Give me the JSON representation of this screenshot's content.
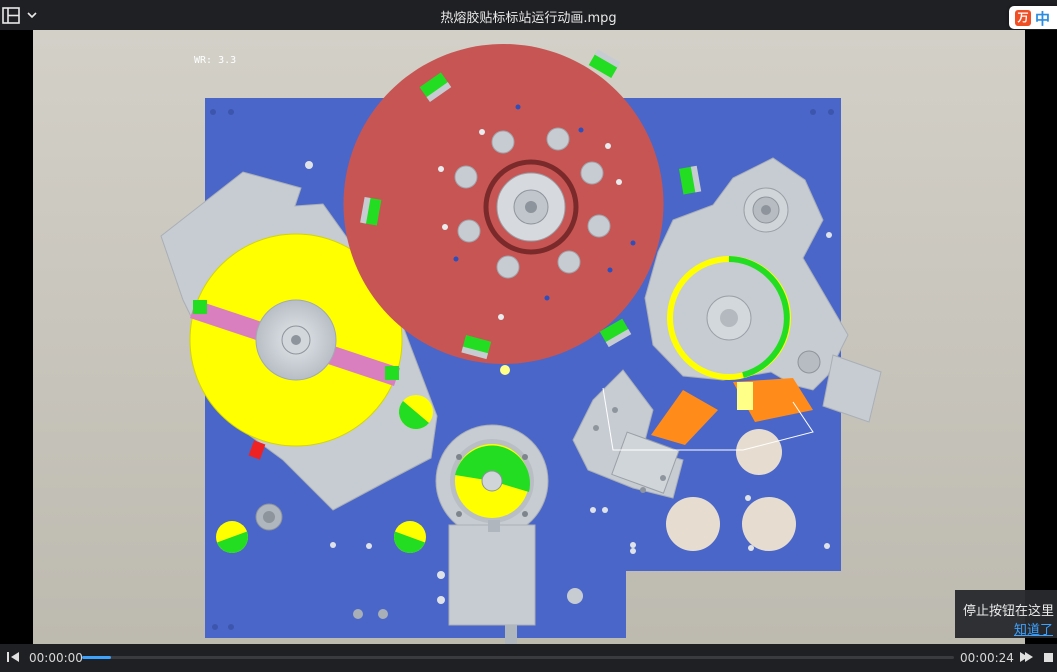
{
  "window": {
    "title": "热熔胶贴标标站运行动画.mpg",
    "ime_indicator": "中"
  },
  "video": {
    "overlay_text": "WR: 3.3",
    "colors": {
      "background": "#c9c6bd",
      "base_plate": "#4a66c9",
      "turret": "#c75553",
      "label_roll": "#ffff00",
      "accent_green": "#22dd22",
      "gray_parts": "#c7ccd2",
      "orange_part": "#ff8c1a",
      "pink_strip": "#d97fc0"
    }
  },
  "player": {
    "current_time": "00:00:00",
    "total_time": "00:00:24",
    "progress": 0.033,
    "icons": [
      "playlist-icon",
      "chevron-down-icon",
      "prev-frame-icon",
      "next-frame-icon",
      "stop-icon"
    ]
  },
  "tooltip": {
    "text": "停止按钮在这里",
    "link": "知道了"
  }
}
